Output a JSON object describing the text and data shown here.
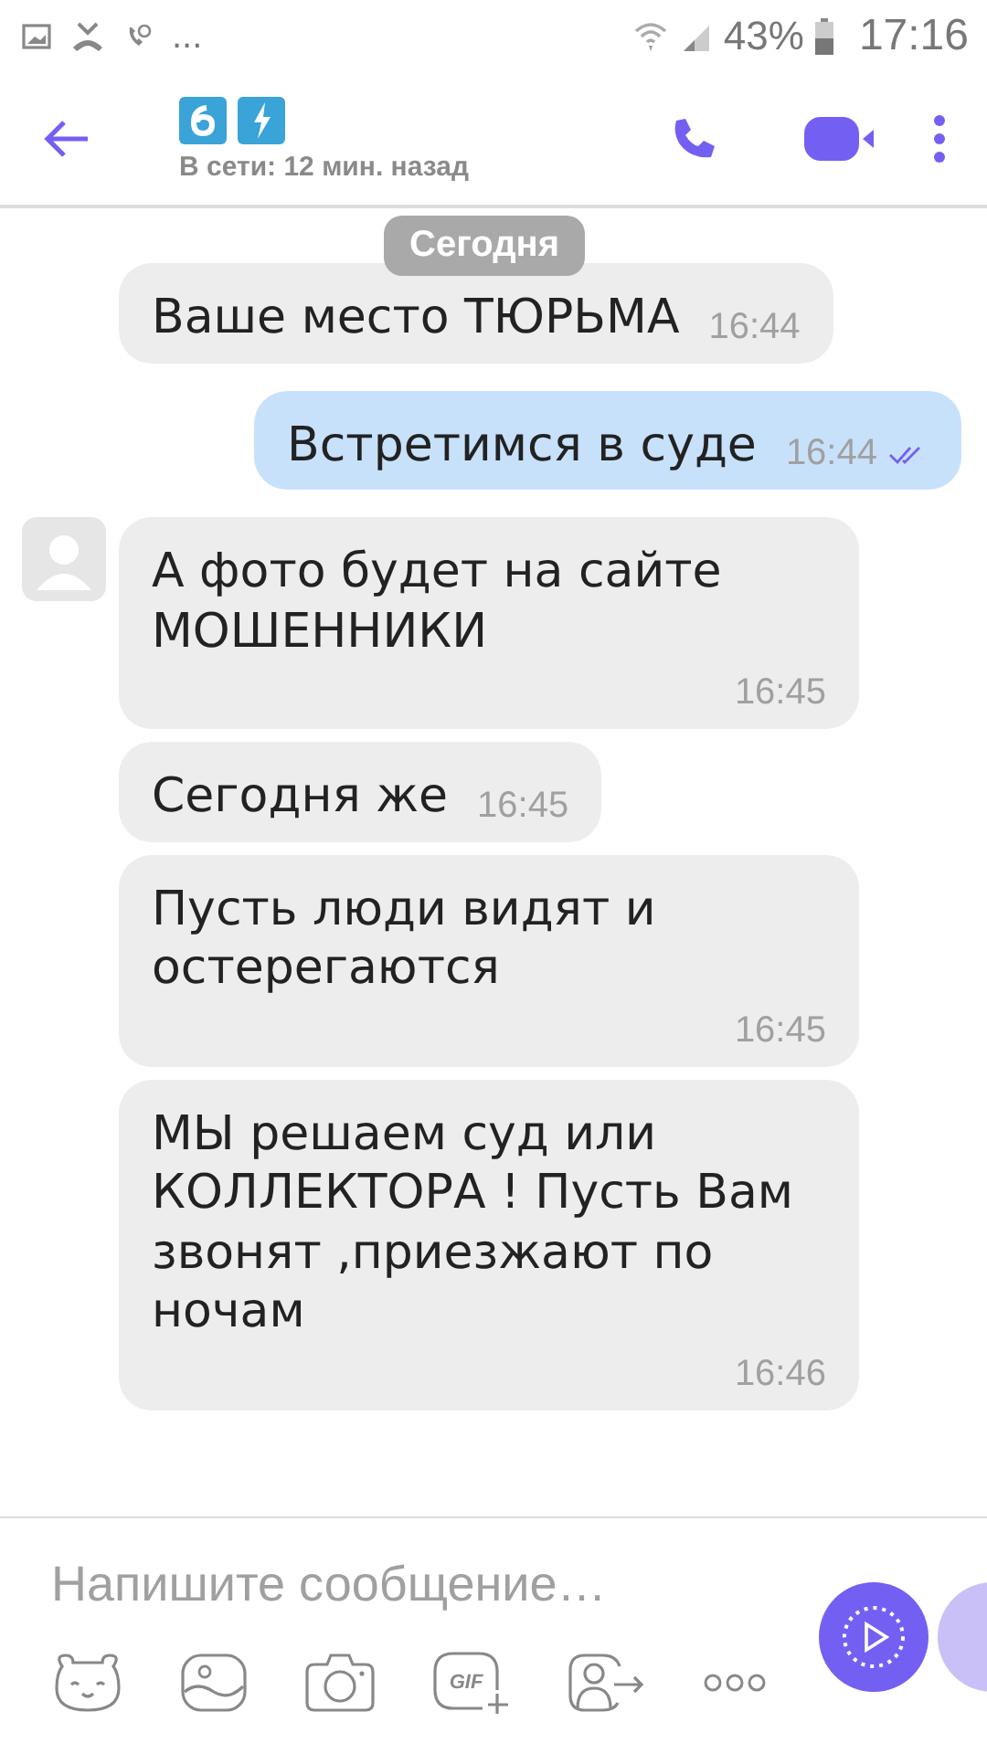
{
  "status_bar": {
    "more": "...",
    "battery": "43%",
    "time": "17:16"
  },
  "header": {
    "subtitle": "В сети: 12 мин. назад"
  },
  "date_pill": "Сегодня",
  "messages": [
    {
      "kind": "incoming",
      "text": "Ваше место ТЮРЬМА",
      "time": "16:44",
      "avatar": false
    },
    {
      "kind": "outgoing",
      "text": "Встретимся в суде",
      "time": "16:44",
      "seen": true
    },
    {
      "kind": "incoming",
      "text": "А фото будет на сайте МОШЕННИКИ",
      "time": "16:45",
      "avatar": true
    },
    {
      "kind": "incoming",
      "text": "Сегодня же",
      "time": "16:45",
      "avatar": false
    },
    {
      "kind": "incoming",
      "text": "Пусть люди видят и остерегаются",
      "time": "16:45",
      "avatar": false
    },
    {
      "kind": "incoming",
      "text": "МЫ решаем суд или КОЛЛЕКТОРА ! Пусть Вам звонят ,приезжают по ночам",
      "time": "16:46",
      "avatar": false
    }
  ],
  "composer": {
    "placeholder": "Напишите сообщение…",
    "gif_label": "GIF"
  }
}
